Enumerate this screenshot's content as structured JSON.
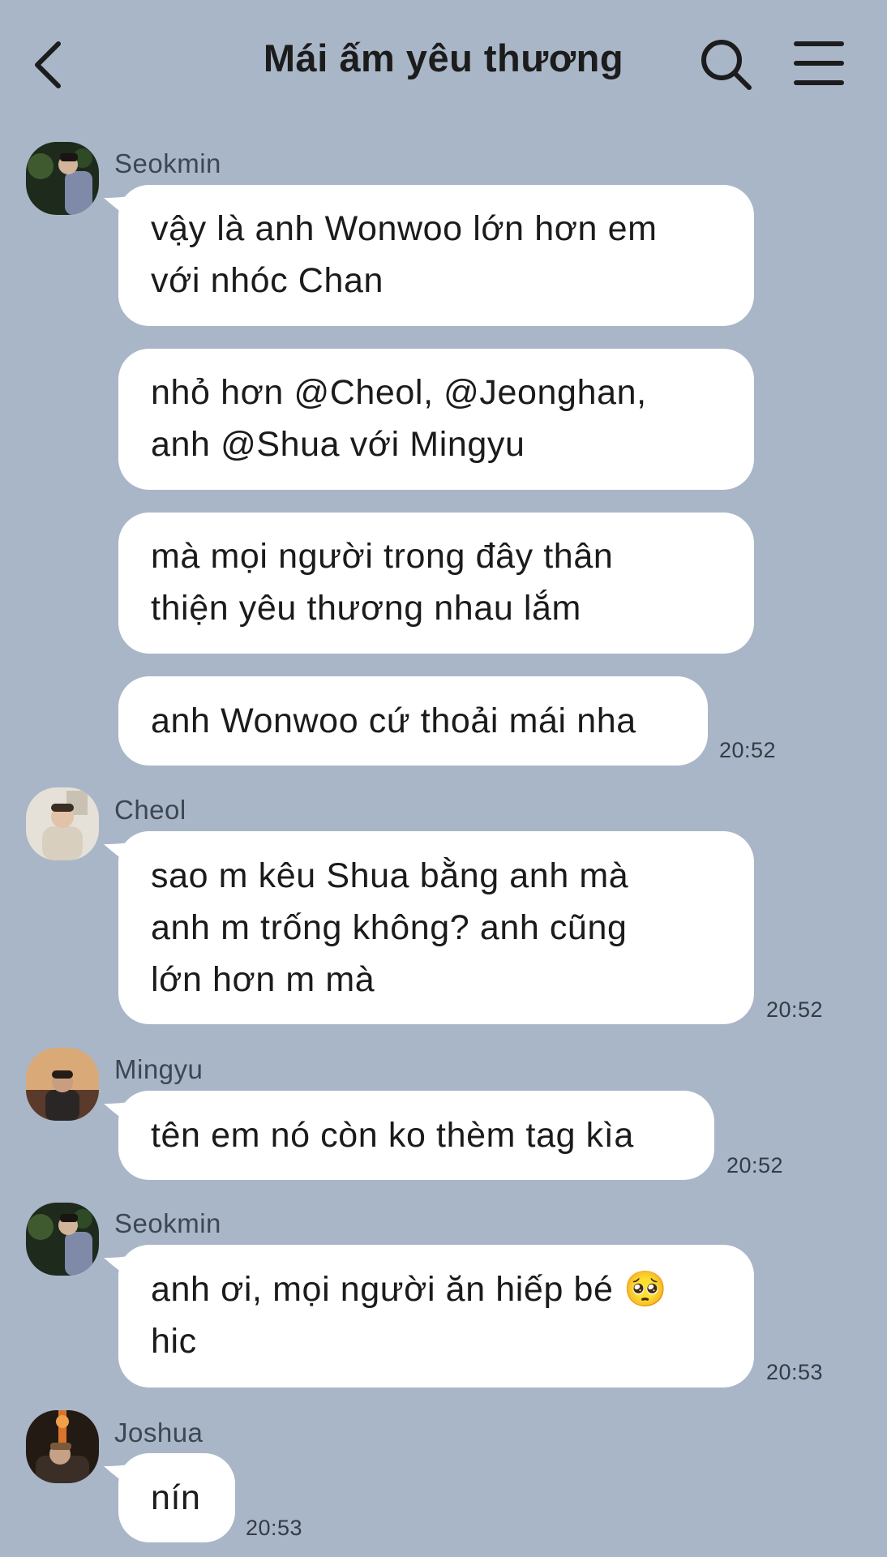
{
  "header": {
    "title": "Mái ấm yêu thương",
    "back_icon": "chevron-left-icon",
    "search_icon": "search-icon",
    "menu_icon": "hamburger-menu-icon"
  },
  "colors": {
    "background": "#a9b6c8",
    "bubble": "#ffffff",
    "text": "#1b1b1b",
    "sender_text": "#3d4653"
  },
  "messages": {
    "g1": {
      "sender": "Seokmin",
      "b1": [
        "vậy là anh Wonwoo lớn hơn em",
        "với nhóc Chan"
      ],
      "b2": [
        "nhỏ hơn @Cheol, @Jeonghan,",
        "anh @Shua với Mingyu"
      ],
      "b3": [
        "mà mọi người trong đây thân",
        "thiện yêu thương nhau lắm"
      ],
      "b4": [
        "anh Wonwoo cứ thoải mái nha"
      ],
      "time": "20:52"
    },
    "g2": {
      "sender": "Cheol",
      "b1": [
        "sao m kêu Shua bằng anh mà",
        "anh m trống không? anh cũng",
        "lớn hơn m mà"
      ],
      "time": "20:52"
    },
    "g3": {
      "sender": "Mingyu",
      "b1": [
        "tên em nó còn ko thèm tag kìa"
      ],
      "time": "20:52"
    },
    "g4": {
      "sender": "Seokmin",
      "b1": [
        "anh ơi, mọi người ăn hiếp bé 🥺",
        "hic"
      ],
      "time": "20:53"
    },
    "g5": {
      "sender": "Joshua",
      "b1": [
        "nín"
      ],
      "time": "20:53"
    }
  }
}
